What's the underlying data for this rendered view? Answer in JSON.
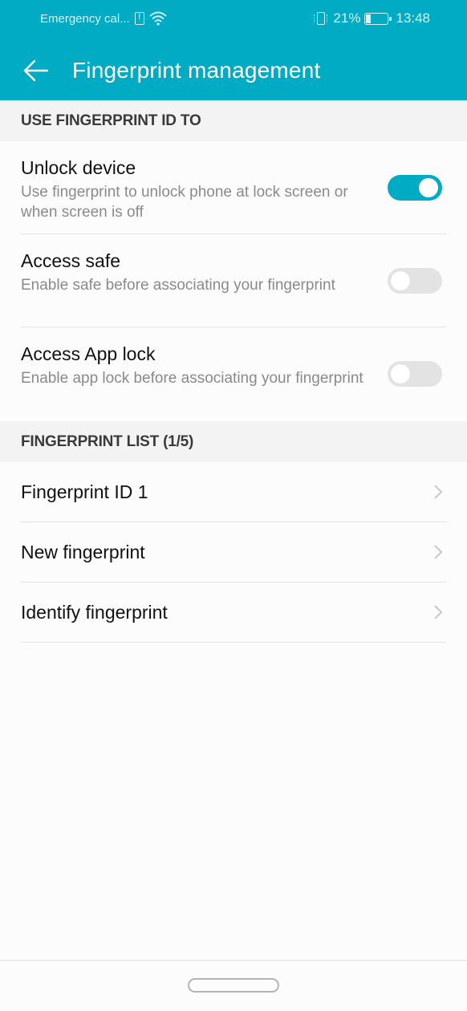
{
  "status_bar": {
    "carrier": "Emergency cal...",
    "battery_percent": "21%",
    "battery_level": 0.21,
    "time": "13:48",
    "icons": [
      "sim-alert-icon",
      "wifi-icon",
      "vibrate-icon",
      "battery-icon"
    ]
  },
  "app_bar": {
    "back_icon": "arrow-left-icon",
    "title": "Fingerprint management"
  },
  "colors": {
    "accent": "#00abc3",
    "section_bg": "#f3f3f3",
    "switch_off": "#e3e3e3"
  },
  "use_section": {
    "header": "USE FINGERPRINT ID TO",
    "items": [
      {
        "title": "Unlock device",
        "subtitle": "Use fingerprint to unlock phone at lock screen or when screen is off",
        "enabled": true
      },
      {
        "title": "Access safe",
        "subtitle": "Enable safe before associating your fingerprint",
        "enabled": false
      },
      {
        "title": "Access App lock",
        "subtitle": "Enable app lock before associating your fingerprint",
        "enabled": false
      }
    ]
  },
  "list_section": {
    "header": "FINGERPRINT LIST (1/5)",
    "items": [
      {
        "label": "Fingerprint ID 1"
      },
      {
        "label": "New fingerprint"
      },
      {
        "label": "Identify fingerprint"
      }
    ]
  }
}
